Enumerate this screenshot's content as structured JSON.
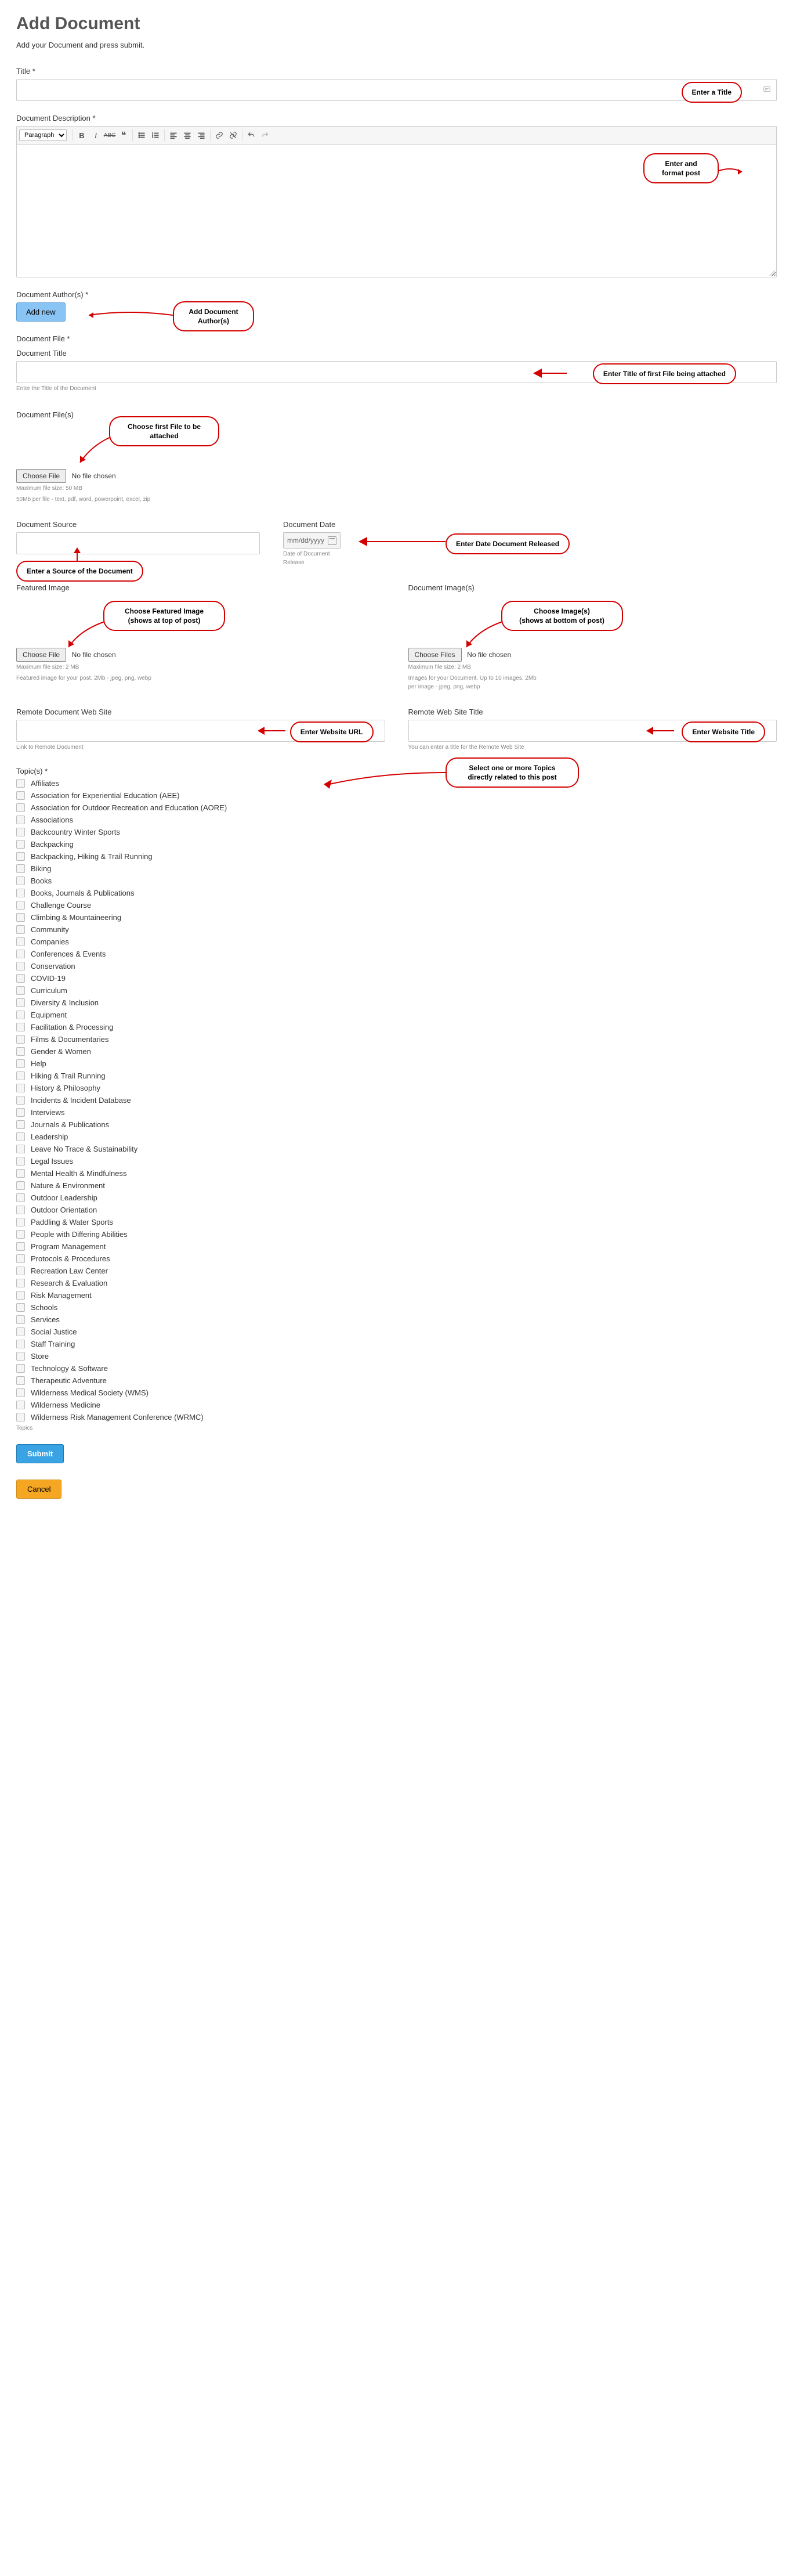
{
  "page": {
    "title": "Add Document",
    "intro": "Add your Document and press submit."
  },
  "title_field": {
    "label": "Title *"
  },
  "desc_field": {
    "label": "Document Description *",
    "paragraph_dropdown": "Paragraph"
  },
  "authors": {
    "label": "Document Author(s) *",
    "add_new": "Add new"
  },
  "doc_file": {
    "label": "Document File *"
  },
  "doc_title": {
    "label": "Document Title",
    "helper": "Enter the Title of the Document"
  },
  "doc_files": {
    "label": "Document File(s)",
    "choose": "Choose File",
    "none": "No file chosen",
    "max": "Maximum file size: 50 MB",
    "note": "50Mb per file - text, pdf, word, powerpoint, excel, zip"
  },
  "doc_source": {
    "label": "Document Source"
  },
  "doc_date": {
    "label": "Document Date",
    "placeholder": "mm/dd/yyyy",
    "helper1": "Date of Document",
    "helper2": "Release"
  },
  "feat_image": {
    "label": "Featured Image",
    "choose": "Choose File",
    "none": "No file chosen",
    "max": "Maximum file size: 2 MB",
    "note": "Featured image for your post. 2Mb - jpeg, png, webp"
  },
  "doc_images": {
    "label": "Document Image(s)",
    "choose": "Choose Files",
    "none": "No file chosen",
    "max": "Maximum file size: 2 MB",
    "note1": "Images for your Document. Up to 10 images, 2Mb",
    "note2": "per image - jpeg, png, webp"
  },
  "remote_site": {
    "label": "Remote Document Web Site",
    "helper": "Link to Remote Document"
  },
  "remote_title": {
    "label": "Remote Web Site Title",
    "helper": "You can enter a title for the Remote Web Site"
  },
  "topics": {
    "label": "Topic(s) *",
    "footer": "Topics",
    "items": [
      "Affiliates",
      "Association for Experiential Education (AEE)",
      "Association for Outdoor Recreation and Education (AORE)",
      "Associations",
      "Backcountry Winter Sports",
      "Backpacking",
      "Backpacking, Hiking & Trail Running",
      "Biking",
      "Books",
      "Books, Journals & Publications",
      "Challenge Course",
      "Climbing & Mountaineering",
      "Community",
      "Companies",
      "Conferences & Events",
      "Conservation",
      "COVID-19",
      "Curriculum",
      "Diversity & Inclusion",
      "Equipment",
      "Facilitation & Processing",
      "Films & Documentaries",
      "Gender & Women",
      "Help",
      "Hiking & Trail Running",
      "History & Philosophy",
      "Incidents & Incident Database",
      "Interviews",
      "Journals & Publications",
      "Leadership",
      "Leave No Trace & Sustainability",
      "Legal Issues",
      "Mental Health & Mindfulness",
      "Nature & Environment",
      "Outdoor Leadership",
      "Outdoor Orientation",
      "Paddling & Water Sports",
      "People with Differing Abilities",
      "Program Management",
      "Protocols & Procedures",
      "Recreation Law Center",
      "Research & Evaluation",
      "Risk Management",
      "Schools",
      "Services",
      "Social Justice",
      "Staff Training",
      "Store",
      "Technology & Software",
      "Therapeutic Adventure",
      "Wilderness Medical Society (WMS)",
      "Wilderness Medicine",
      "Wilderness Risk Management Conference (WRMC)"
    ]
  },
  "buttons": {
    "submit": "Submit",
    "cancel": "Cancel"
  },
  "callouts": {
    "title": "Enter a Title",
    "desc": "Enter and\nformat post",
    "authors": "Add Document\nAuthor(s)",
    "doc_title": "Enter Title of first File being attached",
    "doc_file": "Choose first File to be\nattached",
    "doc_source": "Enter a Source of the Document",
    "doc_date": "Enter Date Document Released",
    "feat_image": "Choose Featured Image\n(shows at top of post)",
    "doc_images": "Choose Image(s)\n(shows at bottom of post)",
    "remote_site": "Enter Website URL",
    "remote_title": "Enter Website Title",
    "topics": "Select one or more Topics\ndirectly related to this post"
  }
}
